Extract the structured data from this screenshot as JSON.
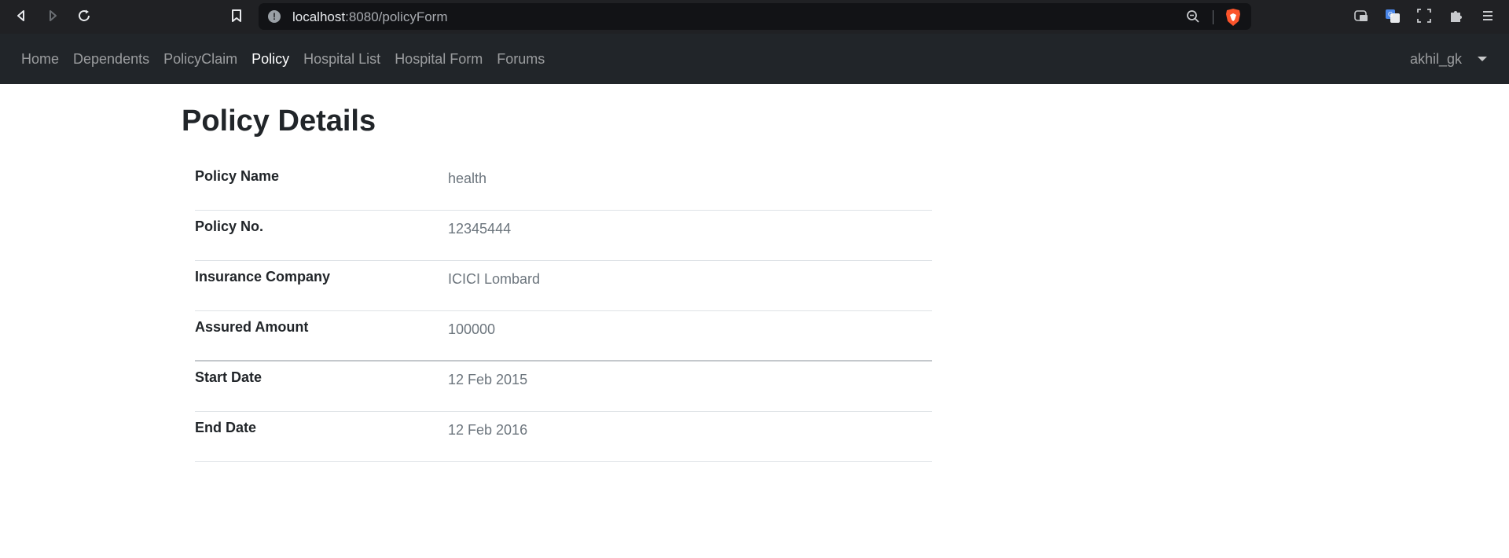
{
  "browser": {
    "url_host": "localhost",
    "url_rest": ":8080/policyForm"
  },
  "navbar": {
    "links": [
      {
        "label": "Home"
      },
      {
        "label": "Dependents"
      },
      {
        "label": "PolicyClaim"
      },
      {
        "label": "Policy"
      },
      {
        "label": "Hospital List"
      },
      {
        "label": "Hospital Form"
      },
      {
        "label": "Forums"
      }
    ],
    "active": "Policy",
    "user": "akhil_gk"
  },
  "page": {
    "title": "Policy Details",
    "details": [
      {
        "label": "Policy Name",
        "value": "health"
      },
      {
        "label": "Policy No.",
        "value": "12345444"
      },
      {
        "label": "Insurance Company",
        "value": "ICICI Lombard"
      },
      {
        "label": "Assured Amount",
        "value": "100000"
      },
      {
        "label": "Start Date",
        "value": "12 Feb 2015"
      },
      {
        "label": "End Date",
        "value": "12 Feb 2016"
      }
    ]
  },
  "colors": {
    "navbar_bg": "#212529",
    "browser_bg": "#202124",
    "brave_accent": "#fb542b"
  }
}
